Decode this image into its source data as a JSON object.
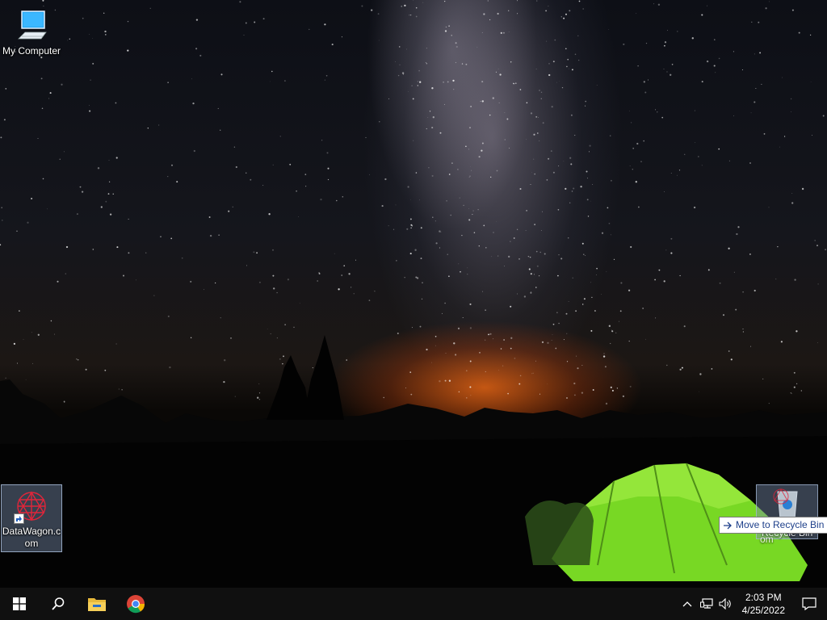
{
  "desktop": {
    "icons": [
      {
        "label": "My Computer",
        "icon": "monitor-icon"
      },
      {
        "label": "DataWagon.com",
        "icon": "datawagon-app-icon"
      },
      {
        "label": "Recycle Bin",
        "icon": "recycle-bin-icon"
      }
    ],
    "drag": {
      "ghost_label": "om",
      "tooltip": "Move to Recycle Bin"
    }
  },
  "taskbar": {
    "start": "windows-start-icon",
    "search": "search-icon",
    "pinned": [
      "file-explorer-icon",
      "chrome-icon"
    ],
    "tray": {
      "icons": [
        "chevron-up-icon",
        "network-icon",
        "volume-icon"
      ],
      "time": "2:03 PM",
      "date": "4/25/2022",
      "notification": "action-center-icon"
    }
  },
  "colors": {
    "taskbar_bg": "#101010",
    "tent_green": "#7fe02a",
    "sky_glow": "#ff6e14"
  }
}
